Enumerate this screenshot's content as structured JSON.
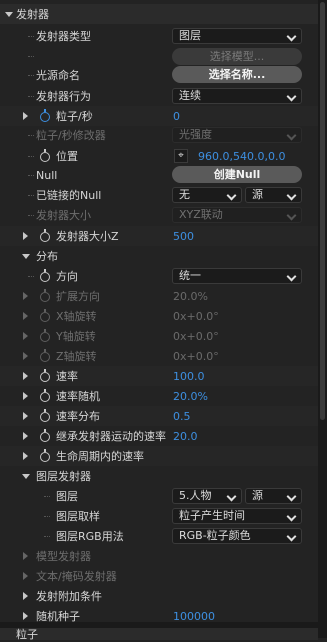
{
  "sections": {
    "emitter": "发射器",
    "particle": "粒子"
  },
  "rows": {
    "emitter_type": {
      "label": "发射器类型",
      "value": "图层"
    },
    "choose_model": {
      "button": "选择模型..."
    },
    "light_naming": {
      "label": "光源命名",
      "button": "选择名称..."
    },
    "emitter_behavior": {
      "label": "发射器行为",
      "value": "连续"
    },
    "particles_per_sec": {
      "label": "粒子/秒",
      "value": "0"
    },
    "pps_modifier": {
      "label": "粒子/秒修改器",
      "value": "光强度"
    },
    "position": {
      "label": "位置",
      "value": "960.0,540.0,0.0"
    },
    "null": {
      "label": "Null",
      "button": "创建Null"
    },
    "linked_null": {
      "label": "已链接的Null",
      "value1": "无",
      "value2": "源"
    },
    "emitter_size": {
      "label": "发射器大小",
      "value": "XYZ联动"
    },
    "emitter_size_z": {
      "label": "发射器大小Z",
      "value": "500"
    },
    "distribution": {
      "label": "分布"
    },
    "direction": {
      "label": "方向",
      "value": "统一"
    },
    "spread": {
      "label": "扩展方向",
      "value": "20.0%"
    },
    "x_rot": {
      "label": "X轴旋转",
      "value": "0x+0.0°"
    },
    "y_rot": {
      "label": "Y轴旋转",
      "value": "0x+0.0°"
    },
    "z_rot": {
      "label": "Z轴旋转",
      "value": "0x+0.0°"
    },
    "velocity": {
      "label": "速率",
      "value": "100.0"
    },
    "velocity_random": {
      "label": "速率随机",
      "value": "20.0%"
    },
    "velocity_distribution": {
      "label": "速率分布",
      "value": "0.5"
    },
    "inherit_velocity": {
      "label": "继承发射器运动的速率",
      "value": "20.0"
    },
    "lifetime_velocity": {
      "label": "生命周期内的速率"
    },
    "layer_emitter": {
      "label": "图层发射器"
    },
    "layer": {
      "label": "图层",
      "value1": "5.人物",
      "value2": "源"
    },
    "layer_sampling": {
      "label": "图层取样",
      "value": "粒子产生时间"
    },
    "layer_rgb": {
      "label": "图层RGB用法",
      "value": "RGB-粒子颜色"
    },
    "model_emitter": {
      "label": "模型发射器"
    },
    "text_mask_emitter": {
      "label": "文本/掩码发射器"
    },
    "emit_conditions": {
      "label": "发射附加条件"
    },
    "random_seed": {
      "label": "随机种子",
      "value": "100000"
    }
  }
}
